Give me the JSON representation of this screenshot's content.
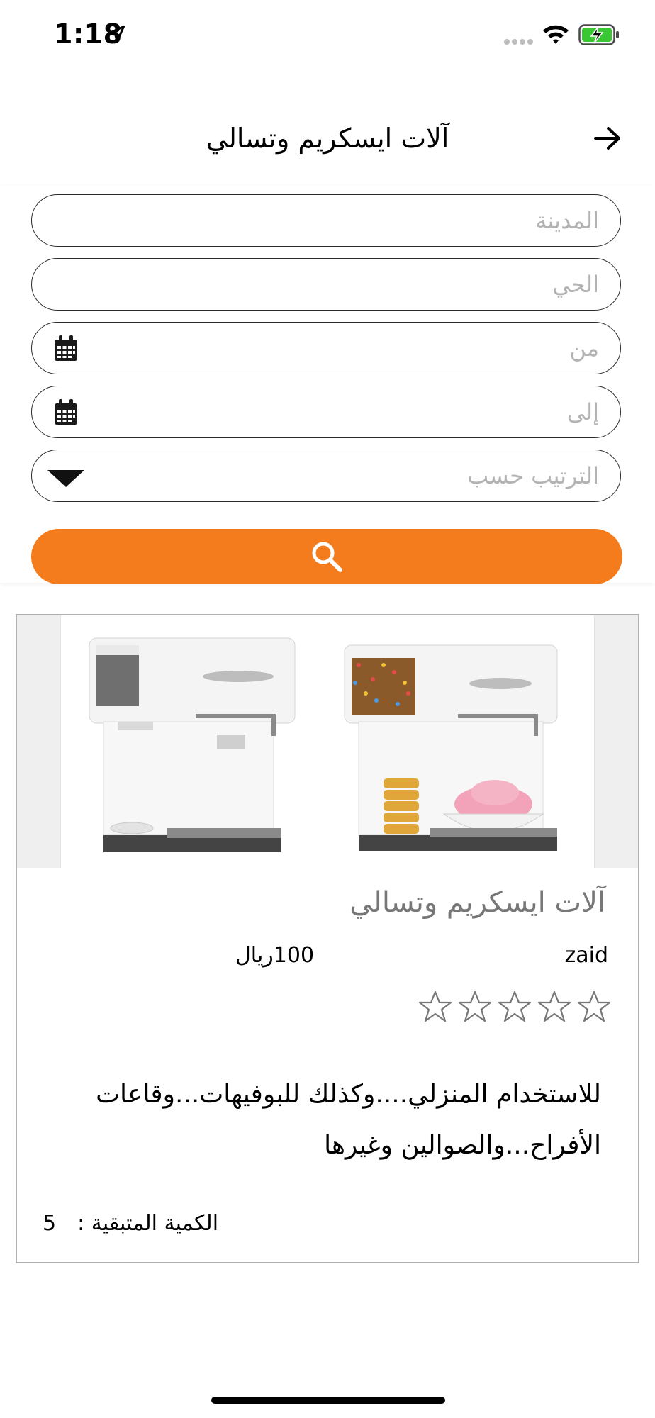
{
  "status_bar": {
    "time": "1:18"
  },
  "header": {
    "title": "آلات ايسكريم وتسالي"
  },
  "filters": {
    "city_placeholder": "المدينة",
    "district_placeholder": "الحي",
    "from_placeholder": "من",
    "to_placeholder": "إلى",
    "sort_placeholder": "الترتيب حسب"
  },
  "accent_color": "#f47c1c",
  "card": {
    "title": "آلات ايسكريم وتسالي",
    "seller": "zaid",
    "price": "100ريال",
    "rating_stars": 0,
    "rating_max": 5,
    "description": "للاستخدام المنزلي....وكذلك للبوفيهات...وقاعات الأفراح...والصوالين وغيرها",
    "quantity_label": "الكمية المتبقية :",
    "quantity_value": "5"
  }
}
